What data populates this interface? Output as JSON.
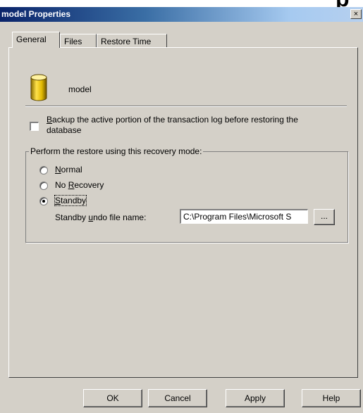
{
  "background_fragment": "p",
  "window": {
    "title": "model Properties",
    "close_glyph": "×"
  },
  "tabs": [
    {
      "label": "General",
      "active": true
    },
    {
      "label": "Files",
      "active": false
    },
    {
      "label": "Restore Time",
      "active": false
    }
  ],
  "database": {
    "icon": "database-cylinder-icon",
    "name": "model"
  },
  "backup_checkbox": {
    "checked": false,
    "line1_access": "B",
    "line1_rest": "ackup the active portion of the transaction log before restoring the",
    "line2": "database"
  },
  "recovery_group": {
    "label": "Perform the restore using this recovery mode:",
    "options": [
      {
        "pre": "",
        "access": "N",
        "post": "ormal",
        "selected": false
      },
      {
        "pre": "No ",
        "access": "R",
        "post": "ecovery",
        "selected": false
      },
      {
        "pre": "",
        "access": "S",
        "post": "tandby",
        "selected": true
      }
    ],
    "undo_label": {
      "pre": "Standby ",
      "access": "u",
      "post": "ndo file name:"
    },
    "undo_value": "C:\\Program Files\\Microsoft S",
    "browse_label": "..."
  },
  "footer": {
    "ok": "OK",
    "cancel": "Cancel",
    "apply": "Apply",
    "help": "Help"
  },
  "colors": {
    "face": "#d4d0c8",
    "title_start": "#0a246a",
    "title_end": "#a6caf0"
  }
}
